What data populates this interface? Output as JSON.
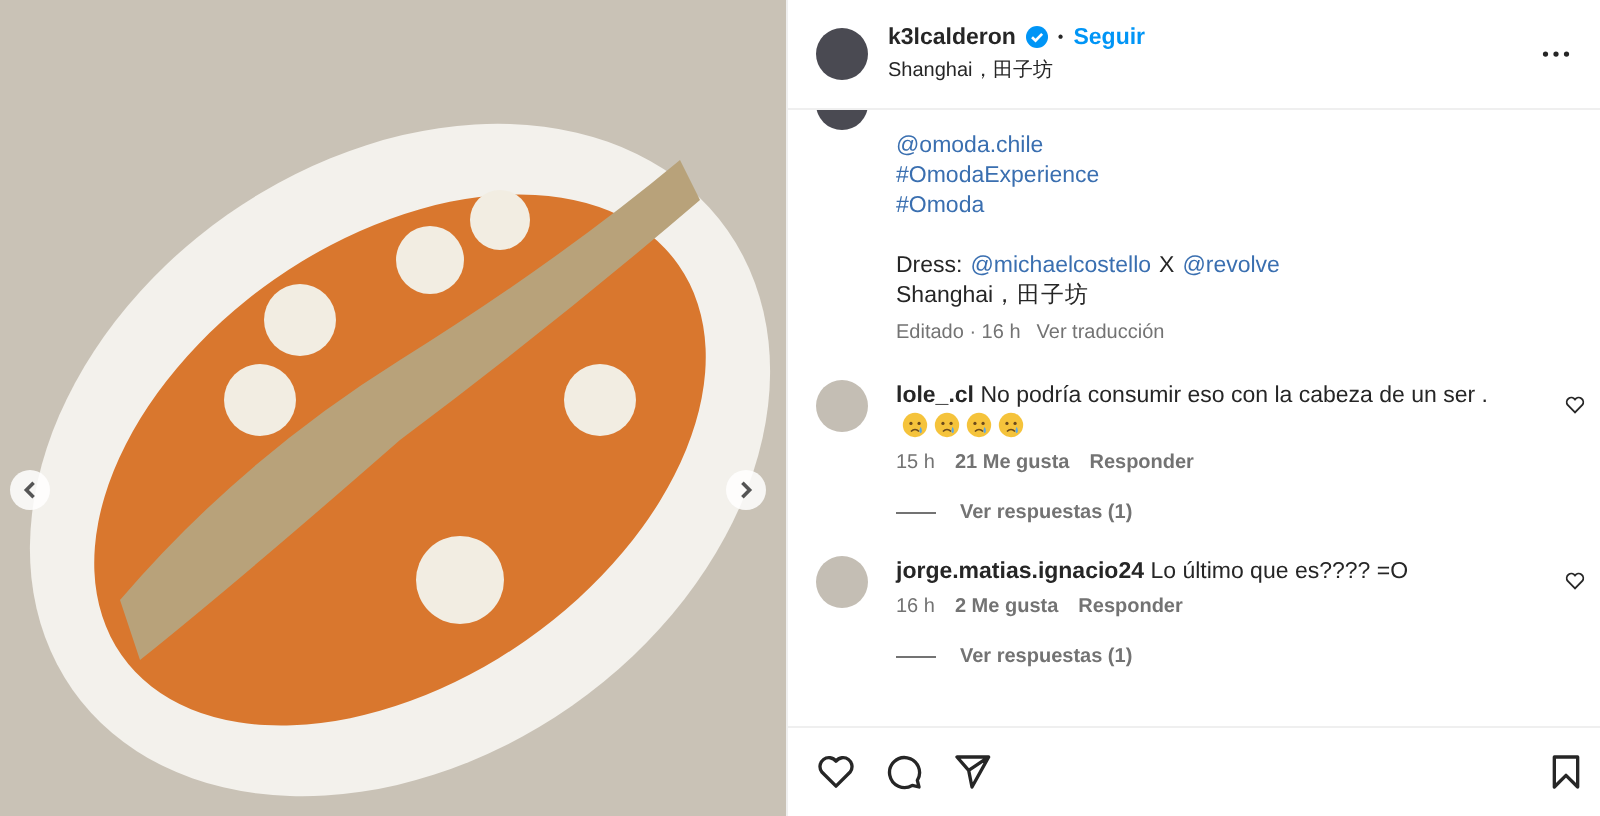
{
  "post": {
    "username": "k3lcalderon",
    "verified": true,
    "separator": "•",
    "follow": "Seguir",
    "location": "Shanghai，田子坊"
  },
  "caption": {
    "lines": [
      "@omoda.chile",
      "#OmodaExperience",
      "#Omoda"
    ],
    "dress_label": "Dress:",
    "dress_mentions": [
      "@michaelcostello",
      "@revolve"
    ],
    "dress_joiner": "X",
    "place": "Shanghai，田子坊",
    "edited": "Editado · 16 h",
    "translate": "Ver traducción"
  },
  "comments": [
    {
      "username": "lole_.cl",
      "text": "No podría consumir eso con la cabeza de un ser .",
      "emojis": [
        {
          "kind": "crying"
        },
        {
          "kind": "crying"
        },
        {
          "kind": "crying"
        },
        {
          "kind": "crying"
        }
      ],
      "time": "15 h",
      "likes": "21 Me gusta",
      "reply": "Responder",
      "replies": "Ver respuestas (1)"
    },
    {
      "username": "jorge.matias.ignacio24",
      "text": "Lo último que es???? =O",
      "time": "16 h",
      "likes": "2 Me gusta",
      "reply": "Responder",
      "replies": "Ver respuestas (1)"
    }
  ]
}
